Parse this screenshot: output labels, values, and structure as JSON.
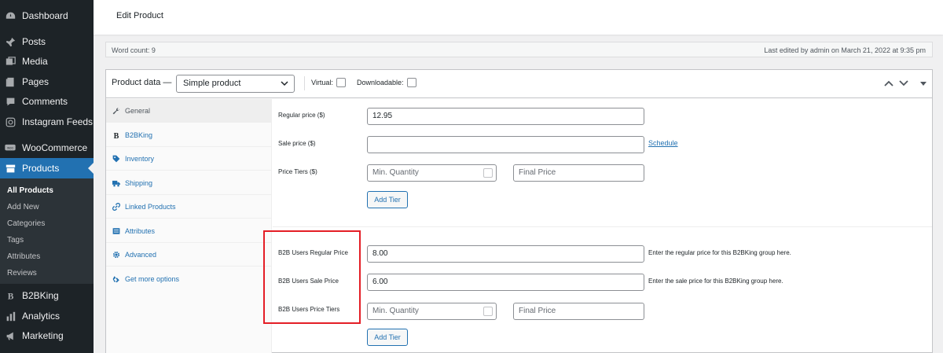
{
  "sidebar": {
    "items": [
      {
        "label": "Dashboard",
        "icon": "dashboard-icon"
      },
      {
        "label": "Posts",
        "icon": "pin-icon"
      },
      {
        "label": "Media",
        "icon": "media-icon"
      },
      {
        "label": "Pages",
        "icon": "pages-icon"
      },
      {
        "label": "Comments",
        "icon": "comment-icon"
      },
      {
        "label": "Instagram Feeds",
        "icon": "instagram-icon"
      },
      {
        "label": "WooCommerce",
        "icon": "woocommerce-icon"
      },
      {
        "label": "Products",
        "icon": "archive-icon"
      },
      {
        "label": "B2BKing",
        "icon": "b2bking-icon"
      },
      {
        "label": "Analytics",
        "icon": "bar-chart-icon"
      },
      {
        "label": "Marketing",
        "icon": "megaphone-icon"
      }
    ],
    "submenu": [
      "All Products",
      "Add New",
      "Categories",
      "Tags",
      "Attributes",
      "Reviews"
    ]
  },
  "header": {
    "title": "Edit Product"
  },
  "wordcount": {
    "left": "Word count: 9",
    "right": "Last edited by admin on March 21, 2022 at 9:35 pm"
  },
  "product_data": {
    "label": "Product data —",
    "type_selected": "Simple product",
    "virtual_label": "Virtual:",
    "downloadable_label": "Downloadable:"
  },
  "tabs": [
    {
      "label": "General",
      "icon": "wrench-icon"
    },
    {
      "label": "B2BKing",
      "icon": "b2bking-tab-icon"
    },
    {
      "label": "Inventory",
      "icon": "tag-icon"
    },
    {
      "label": "Shipping",
      "icon": "truck-icon"
    },
    {
      "label": "Linked Products",
      "icon": "link-icon"
    },
    {
      "label": "Attributes",
      "icon": "list-icon"
    },
    {
      "label": "Advanced",
      "icon": "gear-icon"
    },
    {
      "label": "Get more options",
      "icon": "plugin-icon"
    }
  ],
  "general": {
    "regular_price_label": "Regular price ($)",
    "regular_price_value": "12.95",
    "sale_price_label": "Sale price ($)",
    "sale_price_value": "",
    "schedule_link": "Schedule",
    "price_tiers_label": "Price Tiers ($)",
    "min_qty_placeholder": "Min. Quantity",
    "final_price_placeholder": "Final Price",
    "add_tier_label": "Add Tier"
  },
  "b2b": {
    "regular_label": "B2B Users Regular Price",
    "regular_value": "8.00",
    "regular_desc": "Enter the regular price for this B2BKing group here.",
    "sale_label": "B2B Users Sale Price",
    "sale_value": "6.00",
    "sale_desc": "Enter the sale price for this B2BKing group here.",
    "tiers_label": "B2B Users Price Tiers",
    "min_qty_placeholder": "Min. Quantity",
    "final_price_placeholder": "Final Price",
    "add_tier_label": "Add Tier"
  },
  "colors": {
    "sidebar_bg": "#1d2327",
    "accent": "#2271b1",
    "highlight_box": "#e41e26"
  }
}
